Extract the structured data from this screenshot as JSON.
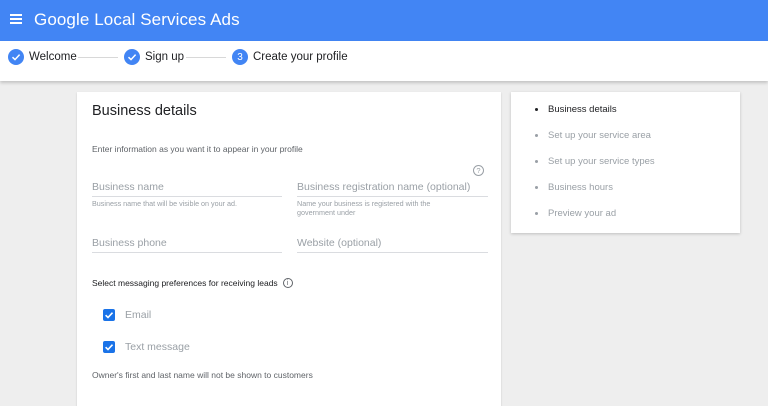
{
  "header": {
    "brand_google": "Google",
    "brand_product": "Local Services Ads",
    "color": "#4285f4"
  },
  "stepper": {
    "steps": [
      {
        "label": "Welcome",
        "state": "done",
        "icon": "check-icon"
      },
      {
        "label": "Sign up",
        "state": "done",
        "icon": "check-icon"
      },
      {
        "label": "Create your profile",
        "state": "current",
        "number": "3"
      }
    ]
  },
  "form": {
    "title": "Business details",
    "intro": "Enter information as you want it to appear in your profile",
    "fields": {
      "business_name": {
        "placeholder": "Business name",
        "hint": "Business name that will be visible on your ad."
      },
      "registration_name": {
        "placeholder": "Business registration name (optional)",
        "hint": "Name your business is registered with the government under"
      },
      "business_phone": {
        "placeholder": "Business phone"
      },
      "website": {
        "placeholder": "Website (optional)"
      }
    },
    "help_icon": "?",
    "messaging_label": "Select messaging preferences for receiving leads",
    "info_icon": "i",
    "messaging_options": [
      {
        "label": "Email",
        "checked": true
      },
      {
        "label": "Text message",
        "checked": true
      }
    ],
    "owner_note": "Owner's first and last name will not be shown to customers"
  },
  "sidebar": {
    "items": [
      {
        "label": "Business details",
        "active": true
      },
      {
        "label": "Set up your service area",
        "active": false
      },
      {
        "label": "Set up your service types",
        "active": false
      },
      {
        "label": "Business hours",
        "active": false
      },
      {
        "label": "Preview your ad",
        "active": false
      }
    ]
  }
}
